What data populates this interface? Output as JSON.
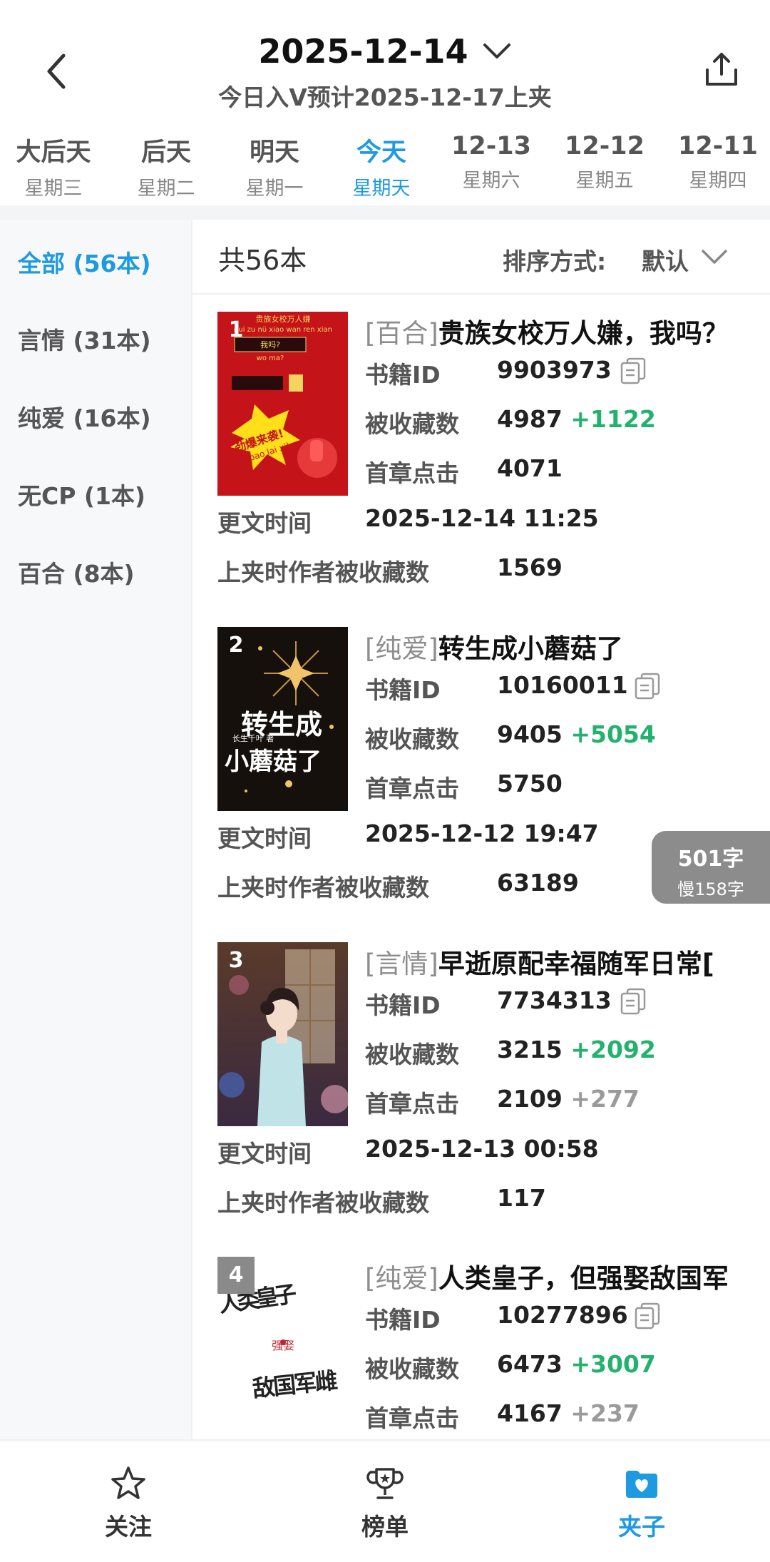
{
  "header": {
    "date": "2025-12-14",
    "subtitle": "今日入V预计2025-12-17上夹"
  },
  "day_tabs": [
    {
      "top": "大后天",
      "bottom": "星期三"
    },
    {
      "top": "后天",
      "bottom": "星期二"
    },
    {
      "top": "明天",
      "bottom": "星期一"
    },
    {
      "top": "今天",
      "bottom": "星期天",
      "active": true
    },
    {
      "top": "12-13",
      "bottom": "星期六"
    },
    {
      "top": "12-12",
      "bottom": "星期五"
    },
    {
      "top": "12-11",
      "bottom": "星期四"
    }
  ],
  "categories": [
    {
      "label": "全部 (56本)",
      "active": true
    },
    {
      "label": "言情 (31本)"
    },
    {
      "label": "纯爱 (16本)"
    },
    {
      "label": "无CP (1本)"
    },
    {
      "label": "百合 (8本)"
    }
  ],
  "list_header": {
    "total": "共56本",
    "sort_label": "排序方式:",
    "sort_value": "默认"
  },
  "labels": {
    "book_id": "书籍ID",
    "favorites": "被收藏数",
    "first_chapter": "首章点击",
    "update_time": "更文时间",
    "author_favorites": "上夹时作者被收藏数"
  },
  "books": [
    {
      "rank": "1",
      "genre": "[百合]",
      "title": "贵族女校万人嫌，我吗？",
      "book_id": "9903973",
      "favorites": "4987",
      "favorites_delta": "+1122",
      "first_chapter": "4071",
      "first_chapter_delta": "",
      "update_time": "2025-12-14 11:25",
      "author_favorites": "1569",
      "cover_text": {
        "line1": "贵族女校万人嫌",
        "line2": "gui zu nü xiao wan ren xian",
        "line3": "我吗?",
        "line4": "wo ma?",
        "line5": "劲爆来袭!",
        "line6": "jing bao lai xi!"
      }
    },
    {
      "rank": "2",
      "genre": "[纯爱]",
      "title": "转生成小蘑菇了",
      "book_id": "10160011",
      "favorites": "9405",
      "favorites_delta": "+5054",
      "first_chapter": "5750",
      "first_chapter_delta": "",
      "update_time": "2025-12-12 19:47",
      "author_favorites": "63189",
      "cover_text": {
        "line1": "转生成",
        "line2": "小蘑菇了",
        "line3": "长生千叶 著"
      }
    },
    {
      "rank": "3",
      "genre": "[言情]",
      "title": "早逝原配幸福随军日常[",
      "book_id": "7734313",
      "favorites": "3215",
      "favorites_delta": "+2092",
      "first_chapter": "2109",
      "first_chapter_delta": "+277",
      "update_time": "2025-12-13 00:58",
      "author_favorites": "117"
    },
    {
      "rank": "4",
      "genre": "[纯爱]",
      "title": "人类皇子，但强娶敌国军",
      "book_id": "10277896",
      "favorites": "6473",
      "favorites_delta": "+3007",
      "first_chapter": "4167",
      "first_chapter_delta": "+237",
      "cover_text": {
        "line1": "人类皇子",
        "line2": "强娶",
        "line3": "敌国军雌"
      }
    }
  ],
  "word_badge": {
    "line1": "501字",
    "line2": "慢158字"
  },
  "bottom_nav": [
    {
      "label": "关注",
      "icon": "star-icon"
    },
    {
      "label": "榜单",
      "icon": "trophy-icon"
    },
    {
      "label": "夹子",
      "icon": "folder-heart-icon",
      "active": true
    }
  ],
  "colors": {
    "accent": "#1e9ae0",
    "positive": "#23b26d",
    "muted": "#9a9a9a"
  }
}
